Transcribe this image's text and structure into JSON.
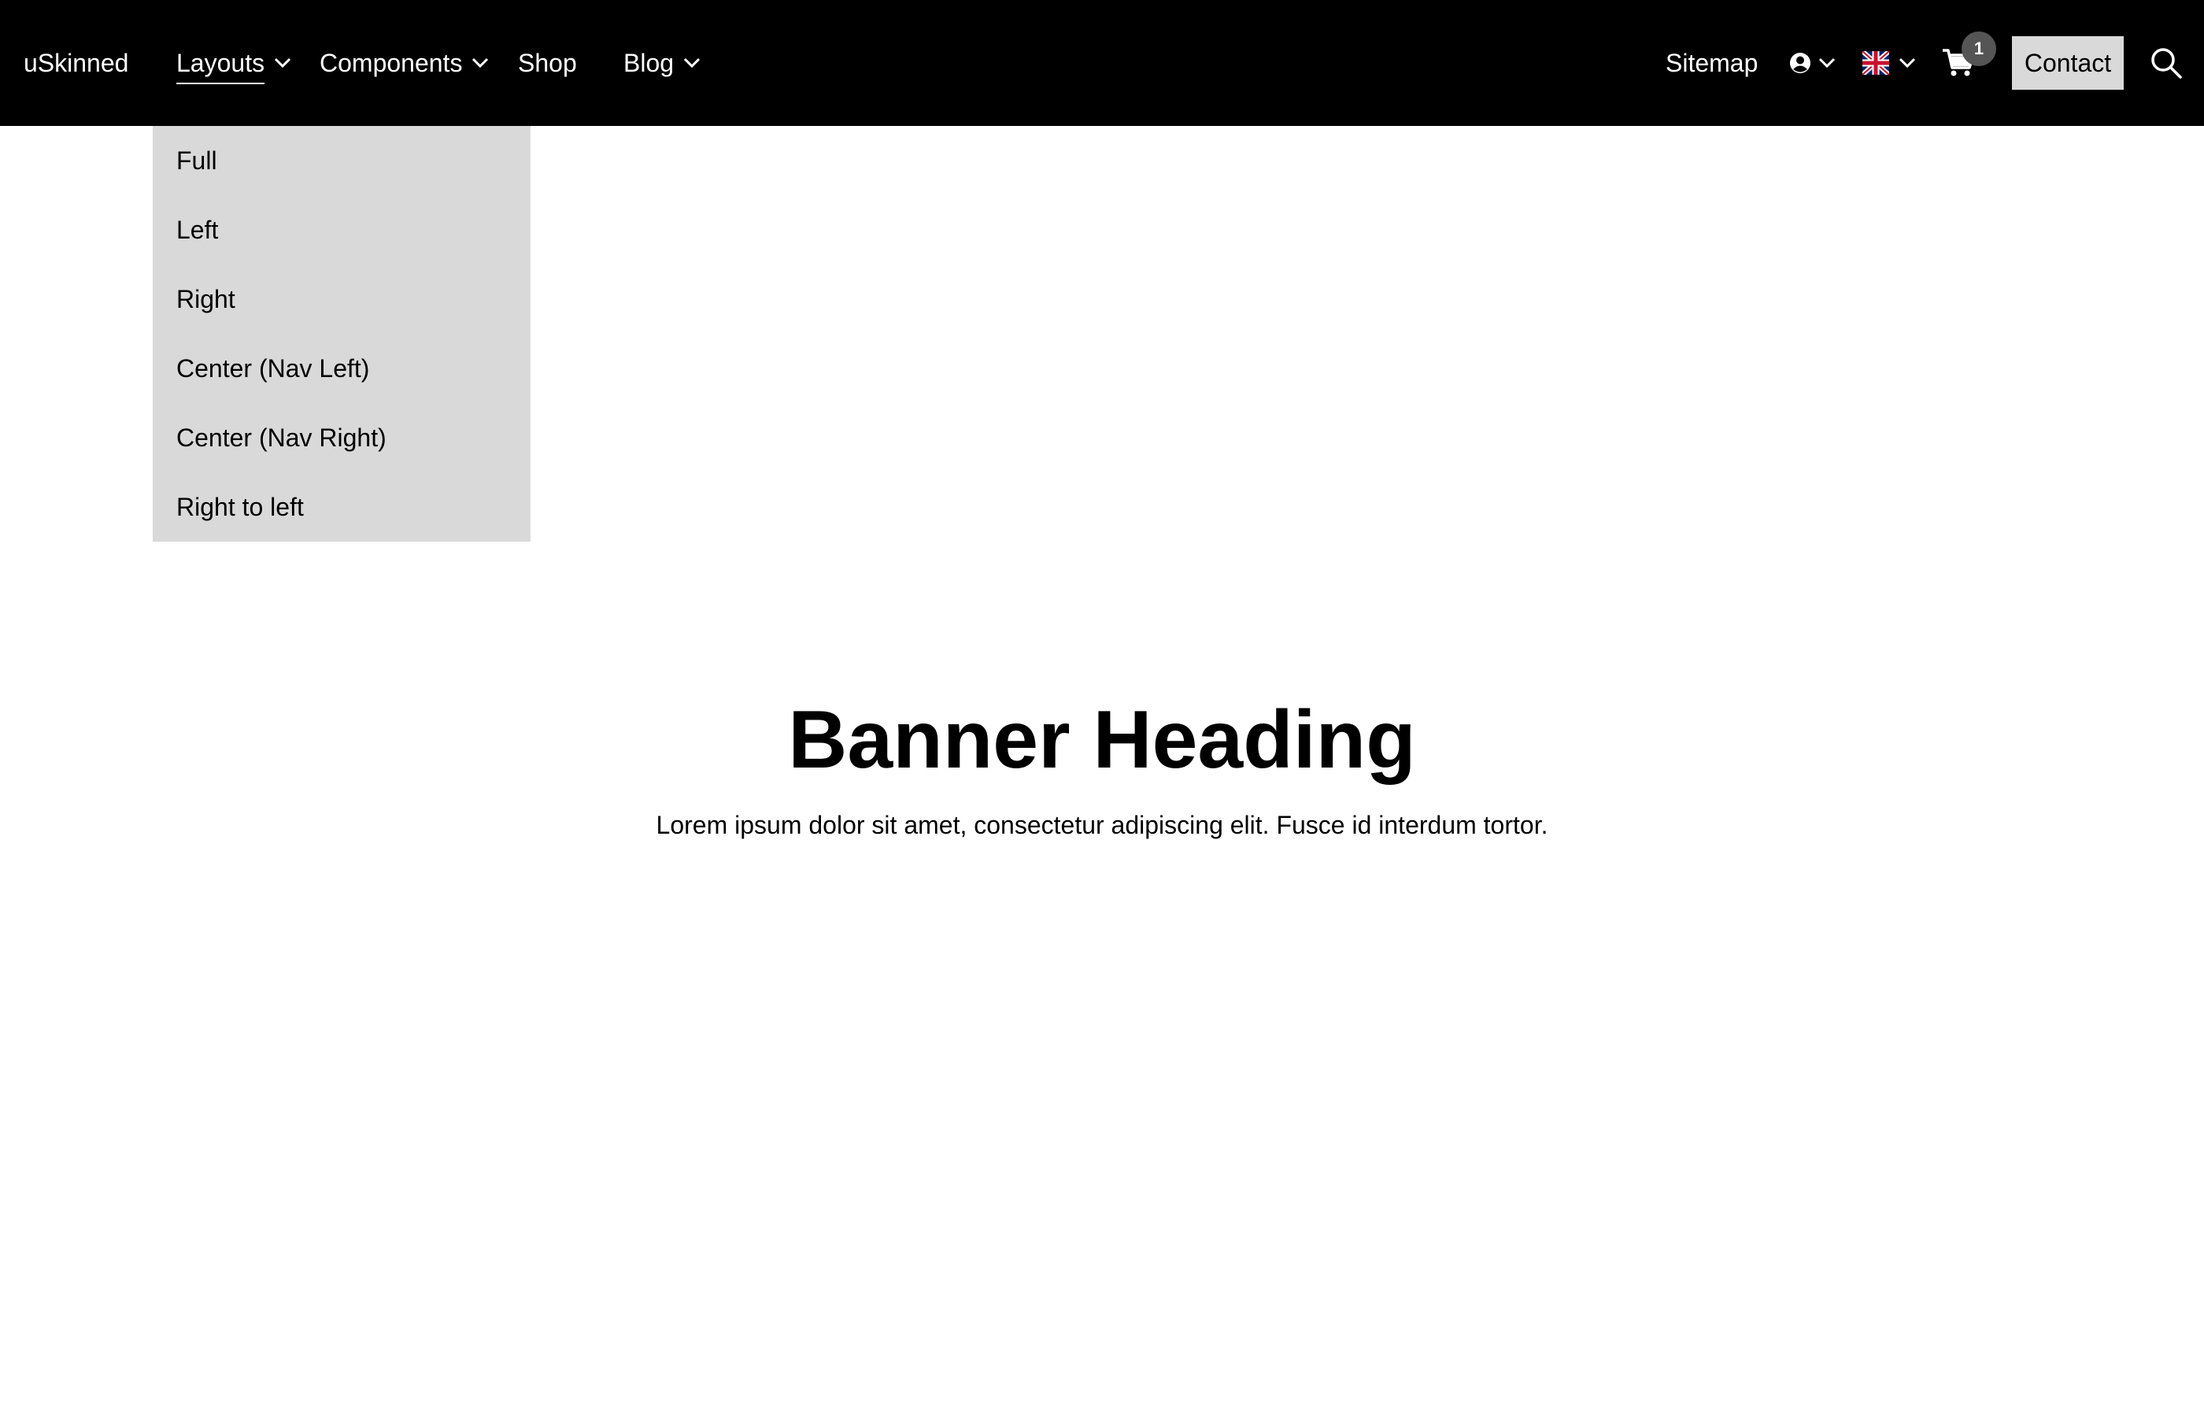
{
  "header": {
    "brand": "uSkinned",
    "nav": [
      {
        "label": "Layouts",
        "has_dropdown": true,
        "active": true
      },
      {
        "label": "Components",
        "has_dropdown": true
      },
      {
        "label": "Shop",
        "has_dropdown": false
      },
      {
        "label": "Blog",
        "has_dropdown": true
      }
    ],
    "sitemap_label": "Sitemap",
    "account_icon": "user-circle-icon",
    "language_icon": "uk-flag-icon",
    "cart_icon": "shopping-cart-icon",
    "cart_count": "1",
    "contact_label": "Contact",
    "search_icon": "search-icon"
  },
  "dropdown": {
    "items": [
      {
        "label": "Full"
      },
      {
        "label": "Left"
      },
      {
        "label": "Right"
      },
      {
        "label": "Center (Nav Left)"
      },
      {
        "label": "Center (Nav Right)"
      },
      {
        "label": "Right to left"
      }
    ]
  },
  "banner": {
    "heading": "Banner Heading",
    "text": "Lorem ipsum dolor sit amet, consectetur adipiscing elit. Fusce id interdum tortor."
  },
  "colors": {
    "header_bg": "#000000",
    "dropdown_bg": "#d9d9d9",
    "contact_bg": "#d9d9d9",
    "badge_bg": "#555555"
  }
}
